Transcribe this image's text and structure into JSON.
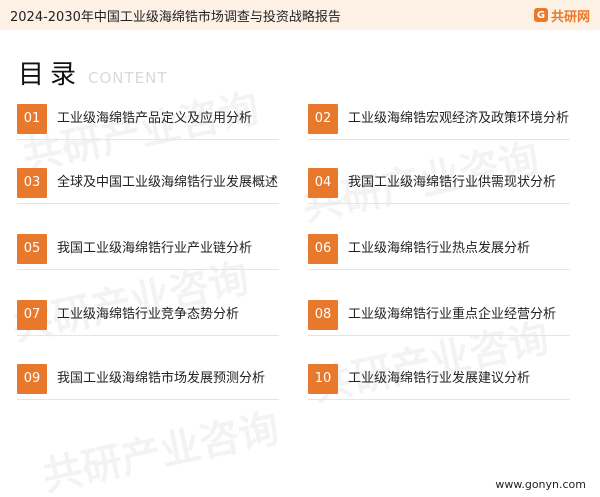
{
  "header": {
    "title": "2024-2030年中国工业级海绵锆市场调查与投资战略报告",
    "logo_text": "共研网",
    "logo_mark": "G"
  },
  "toc": {
    "title": "目录",
    "subtitle": "CONTENT"
  },
  "items": [
    {
      "num": "01",
      "label": "工业级海绵锆产品定义及应用分析"
    },
    {
      "num": "02",
      "label": "工业级海绵锆宏观经济及政策环境分析"
    },
    {
      "num": "03",
      "label": "全球及中国工业级海绵锆行业发展概述"
    },
    {
      "num": "04",
      "label": "我国工业级海绵锆行业供需现状分析"
    },
    {
      "num": "05",
      "label": "我国工业级海绵锆行业产业链分析"
    },
    {
      "num": "06",
      "label": "工业级海绵锆行业热点发展分析"
    },
    {
      "num": "07",
      "label": "工业级海绵锆行业竞争态势分析"
    },
    {
      "num": "08",
      "label": "工业级海绵锆行业重点企业经营分析"
    },
    {
      "num": "09",
      "label": "我国工业级海绵锆市场发展预测分析"
    },
    {
      "num": "10",
      "label": "工业级海绵锆行业发展建议分析"
    }
  ],
  "footer": {
    "url": "www.gonyn.com"
  },
  "colors": {
    "accent": "#e8782c",
    "header_bg": "#fdf1e6"
  }
}
